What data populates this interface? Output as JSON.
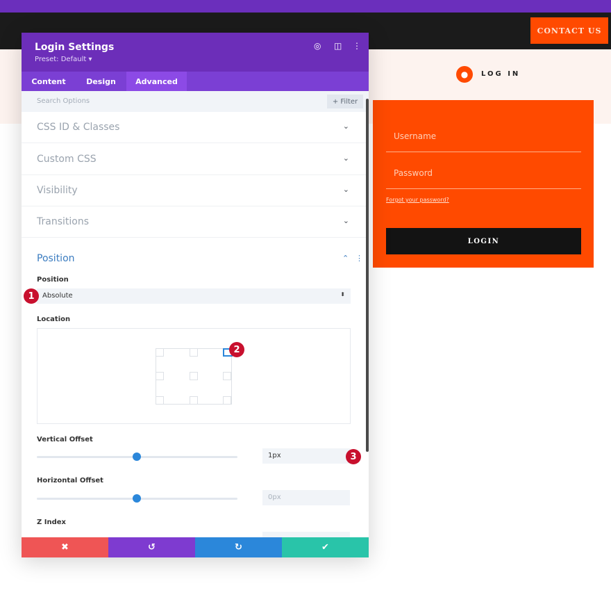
{
  "site": {
    "contact_label": "CONTACT US",
    "login_link": "LOG IN",
    "username_placeholder": "Username",
    "password_placeholder": "Password",
    "forgot_link": "Forgot your password?",
    "login_button": "LOGIN",
    "accent": "#ff4a00"
  },
  "panel": {
    "title": "Login Settings",
    "preset": "Preset: Default ▾",
    "header_color": "#6c2eb9",
    "tabs": [
      {
        "label": "Content"
      },
      {
        "label": "Design"
      },
      {
        "label": "Advanced",
        "active": true
      }
    ],
    "search_placeholder": "Search Options",
    "filter_label": "+ Filter",
    "sections": [
      {
        "label": "CSS ID & Classes"
      },
      {
        "label": "Custom CSS"
      },
      {
        "label": "Visibility"
      },
      {
        "label": "Transitions"
      }
    ],
    "position": {
      "title": "Position",
      "position_label": "Position",
      "position_value": "Absolute",
      "location_label": "Location",
      "location_selected": "top-right",
      "vertical_offset_label": "Vertical Offset",
      "vertical_offset_value": "1px",
      "horizontal_offset_label": "Horizontal Offset",
      "horizontal_offset_placeholder": "0px",
      "z_index_label": "Z Index"
    }
  },
  "footer": {
    "cancel": "✖",
    "undo": "↺",
    "redo": "↻",
    "save": "✔"
  },
  "badges": [
    "1",
    "2",
    "3"
  ]
}
